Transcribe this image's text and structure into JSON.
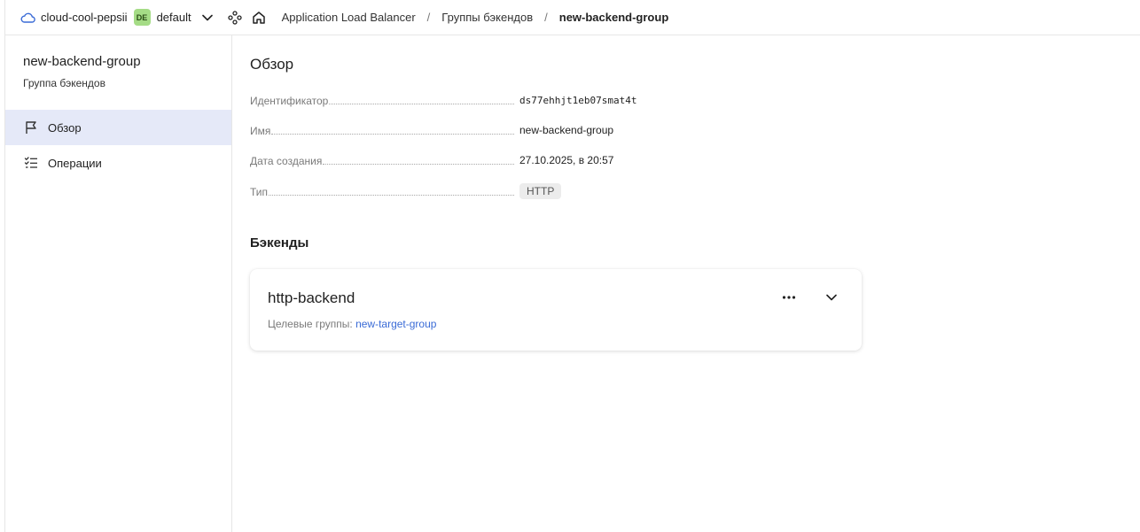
{
  "header": {
    "cloud_name": "cloud-cool-pepsii",
    "folder_badge": "DE",
    "folder_name": "default",
    "breadcrumbs": [
      "Application Load Balancer",
      "Группы бэкендов"
    ],
    "breadcrumb_separator": "/",
    "current": "new-backend-group",
    "icons": [
      "cloud-icon",
      "chevron-down-icon",
      "services-icon",
      "home-icon"
    ]
  },
  "sidebar": {
    "title": "new-backend-group",
    "subtitle": "Группа бэкендов",
    "items": [
      {
        "label": "Обзор",
        "icon": "flag-icon",
        "active": true
      },
      {
        "label": "Операции",
        "icon": "checklist-icon",
        "active": false
      }
    ]
  },
  "main": {
    "overview_title": "Обзор",
    "fields": [
      {
        "key": "Идентификатор",
        "value": "ds77ehhjt1eb07smat4t"
      },
      {
        "key": "Имя",
        "value": "new-backend-group"
      },
      {
        "key": "Дата создания",
        "value": "27.10.2025, в 20:57"
      },
      {
        "key": "Тип",
        "value": "HTTP"
      }
    ],
    "backends_title": "Бэкенды",
    "backend": {
      "name": "http-backend",
      "target_groups_label": "Целевые группы:",
      "target_group": "new-target-group",
      "icons": [
        "more-icon",
        "chevron-down-icon"
      ]
    }
  },
  "colors": {
    "accent": "#3a6bd6",
    "active_nav_bg": "#e5e9f8",
    "folder_badge_bg": "#a5dc86",
    "border": "#e6e6e6"
  }
}
